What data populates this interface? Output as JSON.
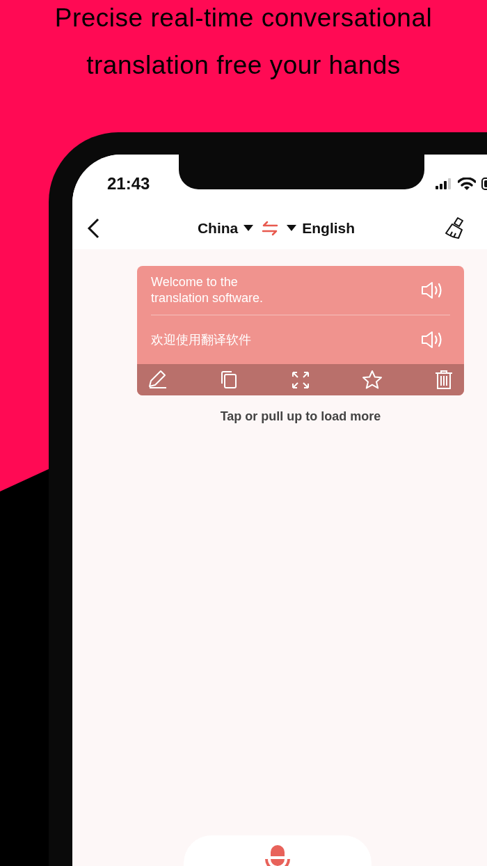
{
  "headline": "Precise real-time conversational translation free your hands",
  "status_bar": {
    "time": "21:43"
  },
  "nav": {
    "source_language": "China",
    "target_language": "English"
  },
  "messages": [
    {
      "entries": [
        {
          "text": "Welcome to the\ntranslation software."
        },
        {
          "text": "欢迎使用翻译软件"
        }
      ]
    }
  ],
  "load_more": "Tap or pull up to load more"
}
